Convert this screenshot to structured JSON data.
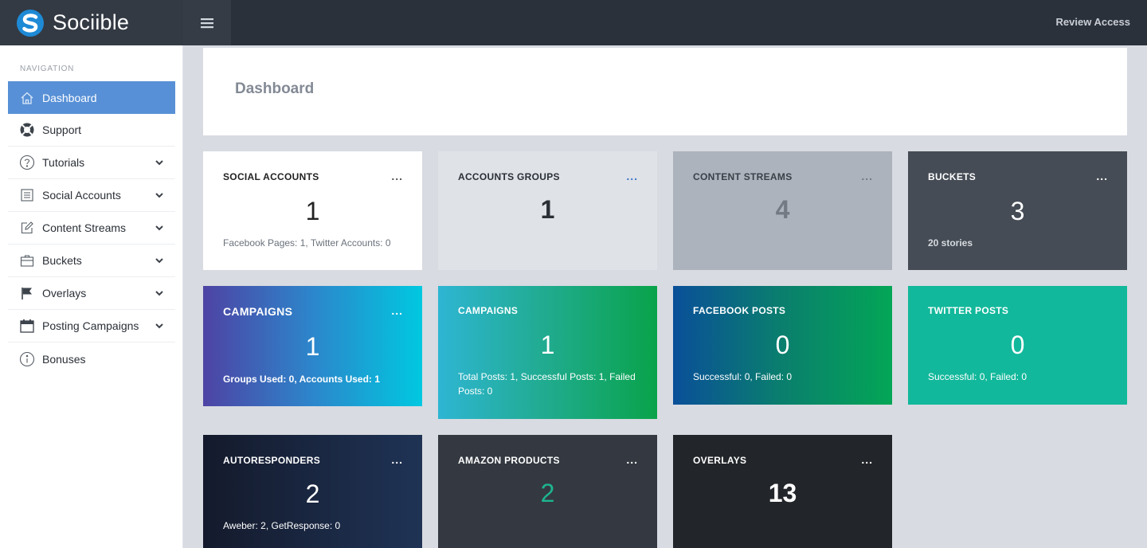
{
  "app": {
    "brand_name": "Sociible",
    "review_link": "Review Access"
  },
  "sidebar": {
    "heading": "NAVIGATION",
    "items": [
      {
        "label": "Dashboard",
        "icon": "home-icon",
        "active": true,
        "expandable": false
      },
      {
        "label": "Support",
        "icon": "lifebuoy-icon",
        "active": false,
        "expandable": false
      },
      {
        "label": "Tutorials",
        "icon": "help-circle-icon",
        "active": false,
        "expandable": true
      },
      {
        "label": "Social Accounts",
        "icon": "list-icon",
        "active": false,
        "expandable": true
      },
      {
        "label": "Content Streams",
        "icon": "edit-icon",
        "active": false,
        "expandable": true
      },
      {
        "label": "Buckets",
        "icon": "briefcase-icon",
        "active": false,
        "expandable": true
      },
      {
        "label": "Overlays",
        "icon": "flag-icon",
        "active": false,
        "expandable": true
      },
      {
        "label": "Posting Campaigns",
        "icon": "calendar-icon",
        "active": false,
        "expandable": true
      },
      {
        "label": "Bonuses",
        "icon": "info-icon",
        "active": false,
        "expandable": false
      }
    ]
  },
  "main": {
    "page_title": "Dashboard",
    "cards": [
      {
        "title": "SOCIAL ACCOUNTS",
        "value": "1",
        "subtitle": "Facebook Pages: 1, Twitter Accounts: 0",
        "menu": "...",
        "value_color": "#222222",
        "menu_color": "#555555"
      },
      {
        "title": "ACCOUNTS GROUPS",
        "value": "1",
        "subtitle": "",
        "menu": "...",
        "value_color": "#2a2f36",
        "menu_color": "#3b78c9"
      },
      {
        "title": "CONTENT STREAMS",
        "value": "4",
        "subtitle": "",
        "menu": "...",
        "value_color": "#737a84",
        "menu_color": "#737a84"
      },
      {
        "title": "BUCKETS",
        "value": "3",
        "subtitle": "20 stories",
        "menu": "...",
        "value_color": "#ffffff",
        "menu_color": "#ffffff"
      },
      {
        "title": "CAMPAIGNS",
        "value": "1",
        "subtitle": "Groups Used: 0, Accounts Used: 1",
        "menu": "...",
        "value_color": "#ffffff",
        "menu_color": "#ffffff"
      },
      {
        "title": "CAMPAIGNS",
        "value": "1",
        "subtitle": "Total Posts: 1, Successful Posts: 1, Failed Posts: 0",
        "menu": "",
        "value_color": "#ffffff",
        "menu_color": "#ffffff"
      },
      {
        "title": "FACEBOOK POSTS",
        "value": "0",
        "subtitle": "Successful: 0, Failed: 0",
        "menu": "",
        "value_color": "#ffffff",
        "menu_color": "#ffffff"
      },
      {
        "title": "TWITTER POSTS",
        "value": "0",
        "subtitle": "Successful: 0, Failed: 0",
        "menu": "",
        "value_color": "#ffffff",
        "menu_color": "#ffffff"
      },
      {
        "title": "AUTORESPONDERS",
        "value": "2",
        "subtitle": "Aweber: 2, GetResponse: 0",
        "menu": "...",
        "value_color": "#ffffff",
        "menu_color": "#ffffff"
      },
      {
        "title": "AMAZON PRODUCTS",
        "value": "2",
        "subtitle": "",
        "menu": "...",
        "value_color": "#1db48f",
        "menu_color": "#ffffff"
      },
      {
        "title": "OVERLAYS",
        "value": "13",
        "subtitle": "",
        "menu": "...",
        "value_color": "#ffffff",
        "menu_color": "#ffffff"
      }
    ]
  },
  "colors": {
    "topbar": "#2b313a",
    "active_nav": "#5790d6",
    "page_background": "#d8dbe1"
  }
}
